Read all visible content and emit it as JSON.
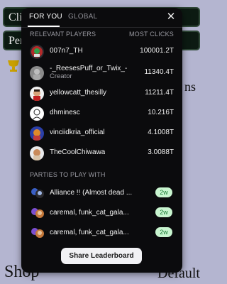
{
  "background": {
    "button1_label": "Clic",
    "button2_label": "Per",
    "right_word": "ns",
    "shop_label": "Shop",
    "default_label": "Default"
  },
  "tabs": [
    {
      "label": "FOR YOU",
      "active": true
    },
    {
      "label": "GLOBAL",
      "active": false
    }
  ],
  "close_icon": "close-icon",
  "players_section": {
    "title": "RELEVANT PLAYERS",
    "column": "MOST CLICKS",
    "players": [
      {
        "name": "007n7_TH",
        "clicks": "100001.2T"
      },
      {
        "name": "-_ReesesPuff_or_Twix_-",
        "subtitle": "Creator",
        "clicks": "11340.4T"
      },
      {
        "name": "yellowcatt_thesilly",
        "clicks": "11211.4T"
      },
      {
        "name": "dhminesc",
        "clicks": "10.216T"
      },
      {
        "name": "vinciidkria_official",
        "clicks": "4.1008T"
      },
      {
        "name": "TheCoolChiwawa",
        "clicks": "3.0088T"
      }
    ]
  },
  "parties_section": {
    "title": "PARTIES TO PLAY WITH",
    "parties": [
      {
        "name": "Alliance !! (Almost dead ...",
        "age": "2w"
      },
      {
        "name": "caremal, funk_cat_gala...",
        "age": "2w"
      },
      {
        "name": "caremal, funk_cat_gala...",
        "age": "2w"
      }
    ]
  },
  "share_button": "Share Leaderboard",
  "colors": {
    "panel_bg": "#0b0b0d",
    "badge_bg": "#c8f5cf",
    "badge_text": "#1b7a35",
    "page_bg": "#b4b5d0"
  }
}
